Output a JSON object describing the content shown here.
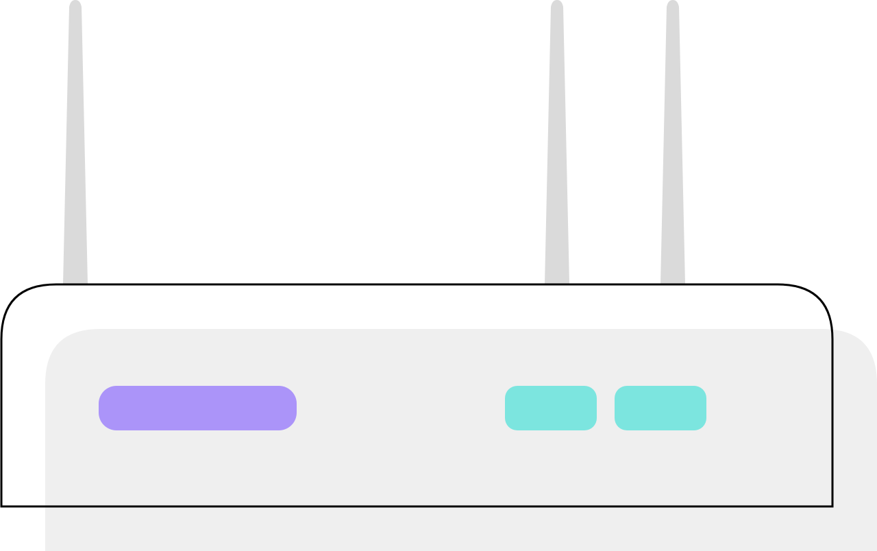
{
  "illustration": {
    "subject": "router-icon",
    "antenna_count": 3,
    "indicator_lights": [
      {
        "name": "status-light-long",
        "color": "#ab94f9"
      },
      {
        "name": "status-light-short-1",
        "color": "#7ce5df"
      },
      {
        "name": "status-light-short-2",
        "color": "#7ce5df"
      }
    ],
    "colors": {
      "background": "#ffffff",
      "antenna": "#dadada",
      "body_shadow": "#efefef",
      "body_outline": "#000000"
    }
  }
}
